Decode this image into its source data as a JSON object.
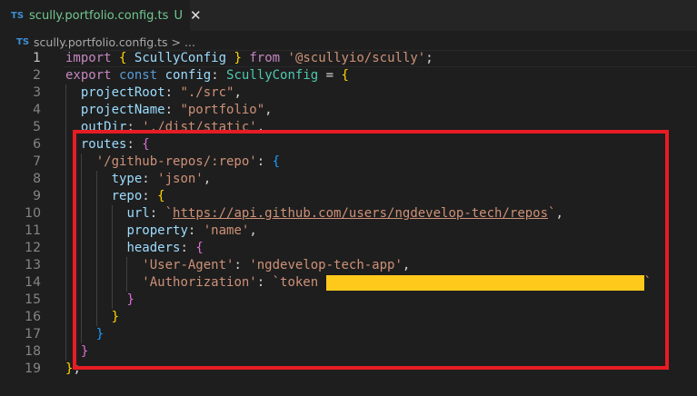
{
  "tab": {
    "lang_badge": "TS",
    "filename": "scully.portfolio.config.ts",
    "status": "U",
    "close": "✕"
  },
  "breadcrumb": {
    "lang_badge": "TS",
    "file": "scully.portfolio.config.ts",
    "sep": ">",
    "more": "..."
  },
  "colors": {
    "highlight_box": "#e81c24",
    "redaction": "#ffc91b"
  },
  "lines": [
    {
      "n": "1",
      "indent": 0,
      "tokens": [
        [
          "k",
          "import"
        ],
        [
          "p",
          " "
        ],
        [
          "b1",
          "{"
        ],
        [
          "p",
          " "
        ],
        [
          "v",
          "ScullyConfig"
        ],
        [
          "p",
          " "
        ],
        [
          "b1",
          "}"
        ],
        [
          "p",
          " "
        ],
        [
          "k",
          "from"
        ],
        [
          "p",
          " "
        ],
        [
          "str",
          "'@scullyio/scully'"
        ],
        [
          "p",
          ";"
        ]
      ]
    },
    {
      "n": "2",
      "indent": 0,
      "tokens": [
        [
          "k",
          "export"
        ],
        [
          "p",
          " "
        ],
        [
          "s",
          "const"
        ],
        [
          "p",
          " "
        ],
        [
          "v",
          "config"
        ],
        [
          "p",
          ": "
        ],
        [
          "t",
          "ScullyConfig"
        ],
        [
          "p",
          " = "
        ],
        [
          "b1",
          "{"
        ]
      ]
    },
    {
      "n": "3",
      "indent": 1,
      "tokens": [
        [
          "v",
          "projectRoot"
        ],
        [
          "p",
          ": "
        ],
        [
          "str",
          "\"./src\""
        ],
        [
          "p",
          ","
        ]
      ]
    },
    {
      "n": "4",
      "indent": 1,
      "tokens": [
        [
          "v",
          "projectName"
        ],
        [
          "p",
          ": "
        ],
        [
          "str",
          "\"portfolio\""
        ],
        [
          "p",
          ","
        ]
      ]
    },
    {
      "n": "5",
      "indent": 1,
      "tokens": [
        [
          "v",
          "outDir"
        ],
        [
          "p",
          ": "
        ],
        [
          "str",
          "'./dist/static'"
        ],
        [
          "p",
          ","
        ]
      ]
    },
    {
      "n": "6",
      "indent": 1,
      "tokens": [
        [
          "v",
          "routes"
        ],
        [
          "p",
          ": "
        ],
        [
          "b2",
          "{"
        ]
      ]
    },
    {
      "n": "7",
      "indent": 2,
      "tokens": [
        [
          "str",
          "'/github-repos/:repo'"
        ],
        [
          "p",
          ": "
        ],
        [
          "b3",
          "{"
        ]
      ]
    },
    {
      "n": "8",
      "indent": 3,
      "tokens": [
        [
          "v",
          "type"
        ],
        [
          "p",
          ": "
        ],
        [
          "str",
          "'json'"
        ],
        [
          "p",
          ","
        ]
      ]
    },
    {
      "n": "9",
      "indent": 3,
      "tokens": [
        [
          "v",
          "repo"
        ],
        [
          "p",
          ": "
        ],
        [
          "b1",
          "{"
        ]
      ]
    },
    {
      "n": "10",
      "indent": 4,
      "tokens": [
        [
          "v",
          "url"
        ],
        [
          "p",
          ": "
        ],
        [
          "str",
          "`"
        ],
        [
          "url",
          "https://api.github.com/users/ngdevelop-tech/repos"
        ],
        [
          "str",
          "`"
        ],
        [
          "p",
          ","
        ]
      ]
    },
    {
      "n": "11",
      "indent": 4,
      "tokens": [
        [
          "v",
          "property"
        ],
        [
          "p",
          ": "
        ],
        [
          "str",
          "'name'"
        ],
        [
          "p",
          ","
        ]
      ]
    },
    {
      "n": "12",
      "indent": 4,
      "tokens": [
        [
          "v",
          "headers"
        ],
        [
          "p",
          ": "
        ],
        [
          "b2",
          "{"
        ]
      ]
    },
    {
      "n": "13",
      "indent": 5,
      "tokens": [
        [
          "str",
          "'User-Agent'"
        ],
        [
          "p",
          ": "
        ],
        [
          "str",
          "'ngdevelop-tech-app'"
        ],
        [
          "p",
          ","
        ]
      ]
    },
    {
      "n": "14",
      "indent": 5,
      "tokens": [
        [
          "str",
          "'Authorization'"
        ],
        [
          "p",
          ": "
        ],
        [
          "str",
          "`token "
        ],
        [
          "redact",
          ""
        ],
        [
          "str",
          "`"
        ]
      ]
    },
    {
      "n": "15",
      "indent": 4,
      "tokens": [
        [
          "b2",
          "}"
        ]
      ]
    },
    {
      "n": "16",
      "indent": 3,
      "tokens": [
        [
          "b1",
          "}"
        ]
      ]
    },
    {
      "n": "17",
      "indent": 2,
      "tokens": [
        [
          "b3",
          "}"
        ]
      ]
    },
    {
      "n": "18",
      "indent": 1,
      "tokens": [
        [
          "b2",
          "}"
        ]
      ]
    },
    {
      "n": "19",
      "indent": 0,
      "tokens": [
        [
          "b1",
          "}"
        ],
        [
          "p",
          ";"
        ]
      ]
    }
  ]
}
